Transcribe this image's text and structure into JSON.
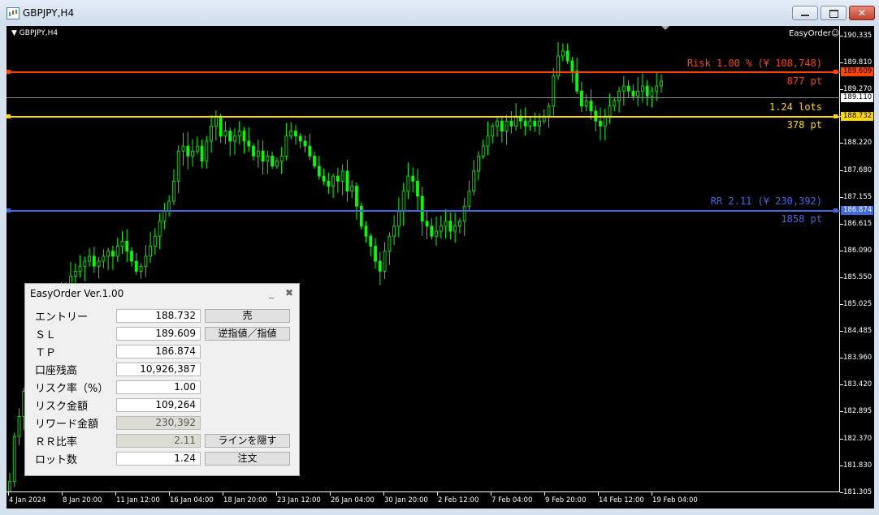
{
  "window": {
    "title": "GBPJPY,H4"
  },
  "chart": {
    "symbol_label": "GBPJPY,H4",
    "ea_label": "EasyOrder☺",
    "colors": {
      "up": "#00ff00",
      "risk": "#ff4500",
      "entry": "#ffd700",
      "tp": "#4169e1",
      "bid": "#c0c0c0",
      "background": "#000000"
    },
    "y_ticks": [
      "190.335",
      "189.810",
      "189.270",
      "188.745",
      "188.220",
      "187.680",
      "187.155",
      "186.615",
      "186.090",
      "185.550",
      "185.025",
      "184.485",
      "183.960",
      "183.420",
      "182.895",
      "182.370",
      "181.830",
      "181.305"
    ],
    "x_ticks": [
      "4 Jan 2024",
      "8 Jan 20:00",
      "11 Jan 12:00",
      "16 Jan 04:00",
      "18 Jan 20:00",
      "23 Jan 12:00",
      "26 Jan 04:00",
      "30 Jan 20:00",
      "2 Feb 12:00",
      "7 Feb 04:00",
      "9 Feb 20:00",
      "14 Feb 12:00",
      "19 Feb 04:00"
    ],
    "lines": {
      "sl": {
        "price": "189.609",
        "label": "Risk 1.00 % (¥ 108,748)",
        "pts": "877 pt"
      },
      "bid": {
        "price": "189.110"
      },
      "entry": {
        "price": "188.732",
        "label": "1.24 lots",
        "pts": "378 pt"
      },
      "tp": {
        "price": "186.874",
        "label": "RR 2.11 (¥ 230,392)",
        "pts": "1858 pt"
      }
    }
  },
  "chart_data": {
    "type": "candlestick",
    "ylim": [
      181.2,
      190.5
    ],
    "close": [
      181.4,
      182.3,
      182.7,
      183.2,
      183.6,
      183.9,
      184.2,
      184.4,
      184.6,
      184.8,
      185.0,
      185.1,
      185.3,
      185.5,
      185.6,
      185.7,
      185.8,
      185.9,
      185.7,
      185.8,
      185.9,
      186.0,
      185.9,
      186.1,
      186.2,
      186.0,
      185.8,
      185.6,
      185.7,
      185.9,
      186.1,
      186.3,
      186.6,
      186.8,
      187.0,
      187.4,
      188.0,
      188.1,
      187.9,
      188.0,
      188.1,
      187.8,
      188.2,
      188.5,
      188.7,
      188.3,
      188.4,
      188.2,
      188.3,
      188.4,
      188.2,
      188.1,
      187.9,
      188.0,
      187.8,
      187.9,
      187.7,
      187.8,
      187.9,
      188.3,
      188.4,
      188.3,
      188.2,
      188.1,
      187.9,
      187.7,
      187.5,
      187.4,
      187.3,
      187.5,
      187.4,
      187.6,
      187.2,
      187.3,
      186.9,
      186.5,
      186.3,
      186.1,
      185.8,
      185.6,
      186.0,
      186.3,
      186.5,
      186.8,
      187.2,
      187.5,
      187.4,
      187.1,
      186.6,
      186.5,
      186.3,
      186.4,
      186.5,
      186.6,
      186.4,
      186.5,
      186.6,
      186.9,
      187.2,
      187.6,
      187.9,
      188.1,
      188.3,
      188.5,
      188.6,
      188.4,
      188.6,
      188.5,
      188.7,
      188.6,
      188.5,
      188.6,
      188.5,
      188.6,
      188.7,
      188.9,
      189.5,
      189.9,
      190.0,
      189.8,
      189.6,
      189.2,
      188.9,
      189.0,
      188.8,
      188.6,
      188.5,
      188.7,
      188.9,
      189.0,
      189.2,
      189.3,
      189.2,
      189.1,
      189.2,
      189.3,
      189.1,
      189.2,
      189.3,
      189.4
    ]
  },
  "panel": {
    "title": "EasyOrder Ver.1.00",
    "minimize": "_",
    "close": "✖",
    "rows": [
      {
        "label": "エントリー",
        "value": "188.732",
        "button": "売"
      },
      {
        "label": "ＳＬ",
        "value": "189.609",
        "button": "逆指値／指値"
      },
      {
        "label": "ＴＰ",
        "value": "186.874"
      },
      {
        "label": "口座残高",
        "value": "10,926,387"
      },
      {
        "label": "リスク率（%）",
        "value": "1.00"
      },
      {
        "label": "リスク金額",
        "value": "109,264"
      },
      {
        "label": "リワード金額",
        "value": "230,392"
      },
      {
        "label": "ＲＲ比率",
        "value": "2.11",
        "button": "ラインを隠す"
      },
      {
        "label": "ロット数",
        "value": "1.24",
        "button": "注文"
      }
    ]
  }
}
